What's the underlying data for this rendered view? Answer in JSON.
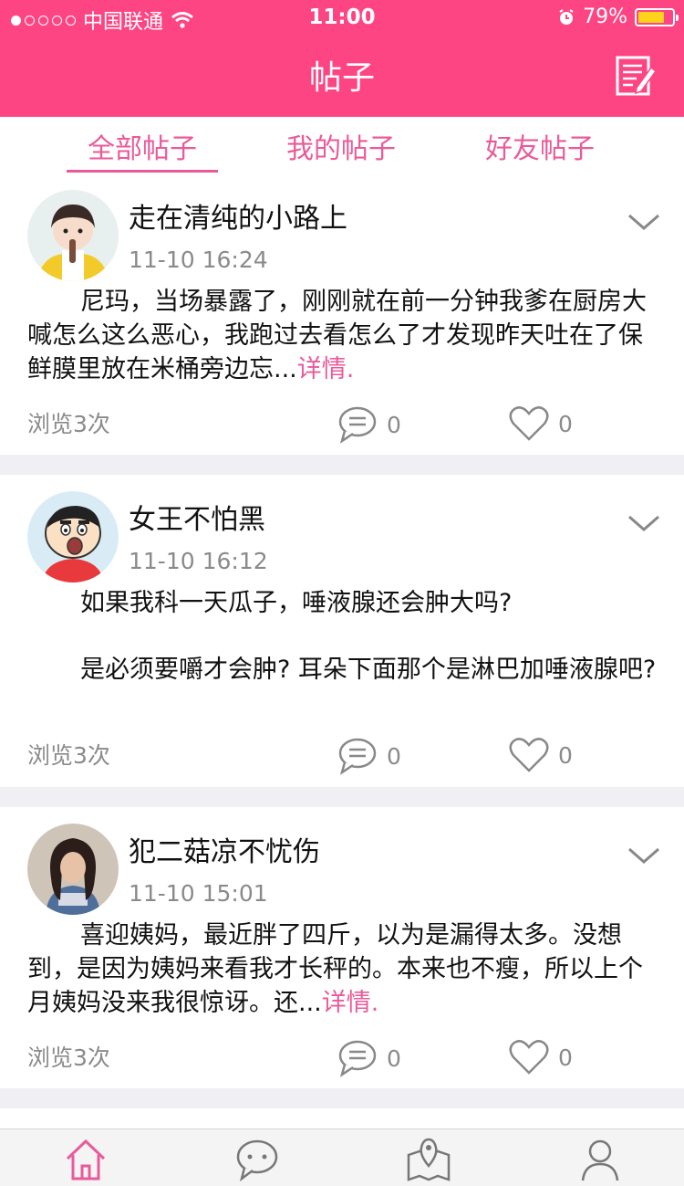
{
  "status_bar": {
    "carrier": "中国联通",
    "time": "11:00",
    "battery": "79%",
    "battery_level": 0.79,
    "signal_bars_filled": 1,
    "signal_bars_total": 5
  },
  "header": {
    "title": "帖子",
    "background_color": "#fe4584",
    "edit_icon": "edit-note-icon"
  },
  "tabs": [
    {
      "label": "全部帖子",
      "active": true
    },
    {
      "label": "我的帖子",
      "active": false
    },
    {
      "label": "好友帖子",
      "active": false
    }
  ],
  "accent_color": "#ea5a9a",
  "posts": [
    {
      "username": "走在清纯的小路上",
      "time": "11-10 16:24",
      "paragraphs": [
        "尼玛，当场暴露了，刚刚就在前一分钟我爹在厨房大喊怎么这么恶心，我跑过去看怎么了才发现昨天吐在了保鲜膜里放在米桶旁边忘..."
      ],
      "more_label": "详情.",
      "views": "浏览3次",
      "comments": "0",
      "likes": "0"
    },
    {
      "username": "女王不怕黑",
      "time": "11-10 16:12",
      "paragraphs": [
        "如果我科一天瓜子，唾液腺还会肿大吗?",
        "是必须要嚼才会肿? 耳朵下面那个是淋巴加唾液腺吧?"
      ],
      "more_label": "",
      "views": "浏览3次",
      "comments": "0",
      "likes": "0"
    },
    {
      "username": "犯二菇凉不忧伤",
      "time": "11-10 15:01",
      "paragraphs": [
        "喜迎姨妈，最近胖了四斤，以为是漏得太多。没想到，是因为姨妈来看我才长秤的。本来也不瘦，所以上个月姨妈没来我很惊讶。还..."
      ],
      "more_label": "详情.",
      "views": "浏览3次",
      "comments": "0",
      "likes": "0"
    }
  ],
  "tab_bar": {
    "items": [
      {
        "icon": "home-icon",
        "active": true
      },
      {
        "icon": "chat-icon",
        "active": false
      },
      {
        "icon": "map-icon",
        "active": false
      },
      {
        "icon": "profile-icon",
        "active": false
      }
    ]
  }
}
